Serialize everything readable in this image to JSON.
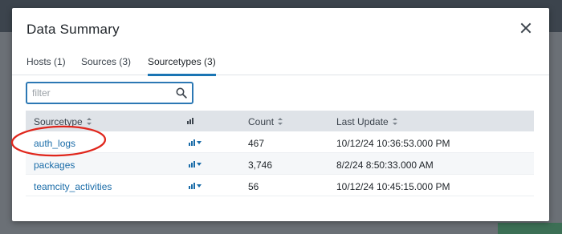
{
  "modal": {
    "title": "Data Summary",
    "tabs": [
      {
        "label": "Hosts (1)",
        "active": false
      },
      {
        "label": "Sources (3)",
        "active": false
      },
      {
        "label": "Sourcetypes (3)",
        "active": true
      }
    ],
    "filter": {
      "placeholder": "filter",
      "value": ""
    },
    "table": {
      "columns": [
        "Sourcetype",
        "",
        "Count",
        "Last Update"
      ],
      "rows": [
        {
          "sourcetype": "auth_logs",
          "count": "467",
          "last_update": "10/12/24 10:36:53.000 PM"
        },
        {
          "sourcetype": "packages",
          "count": "3,746",
          "last_update": "8/2/24 8:50:33.000 AM"
        },
        {
          "sourcetype": "teamcity_activities",
          "count": "56",
          "last_update": "10/12/24 10:45:15.000 PM"
        }
      ]
    }
  },
  "icons": {
    "close": "close-icon",
    "search": "search-icon",
    "sort": "sort-icon",
    "bars": "bar-chart-icon",
    "caret": "caret-down-icon"
  },
  "colors": {
    "accent": "#1a75b4",
    "link": "#1a6ca8",
    "annotation": "#e0261c",
    "header_bg": "#dfe3e8"
  }
}
